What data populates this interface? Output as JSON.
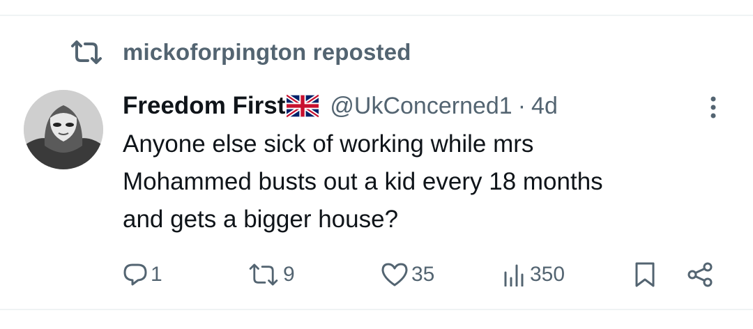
{
  "repost": {
    "text": "mickoforpington reposted",
    "icon": "repost-icon"
  },
  "author": {
    "display_name": "Freedom First",
    "flag": "uk-flag",
    "handle": "@UkConcerned1",
    "separator": "·",
    "time": "4d"
  },
  "post": {
    "lines": [
      "Anyone else sick of working while mrs",
      "Mohammed busts out a kid every 18 months",
      "and gets a bigger house?"
    ]
  },
  "actions": {
    "replies": "1",
    "reposts": "9",
    "likes": "35",
    "views": "350"
  },
  "colors": {
    "text": "#0f1419",
    "secondary": "#536471",
    "divider": "#eff3f4"
  }
}
